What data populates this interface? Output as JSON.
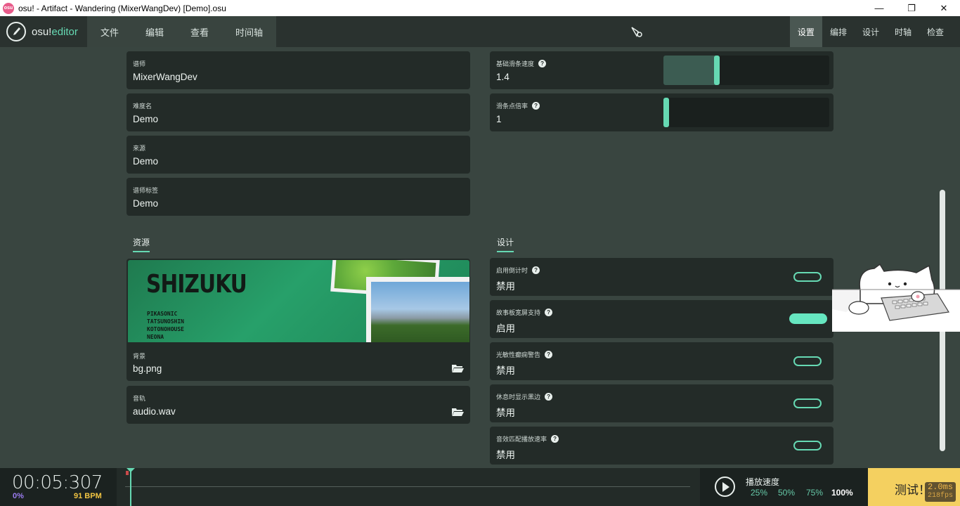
{
  "window": {
    "title": "osu! - Artifact - Wandering (MixerWangDev) [Demo].osu",
    "app_icon_text": "osu",
    "controls": {
      "minimize": "—",
      "maximize": "❐",
      "close": "✕"
    }
  },
  "topbar": {
    "logo": {
      "prefix": "osu!",
      "suffix": "editor"
    },
    "menu": [
      "文件",
      "编辑",
      "查看",
      "时间轴"
    ],
    "modes": [
      "设置",
      "编排",
      "设计",
      "时轴",
      "检查"
    ],
    "active_mode": "设置"
  },
  "metadata": {
    "creator": {
      "label": "谱师",
      "value": "MixerWangDev"
    },
    "difficulty": {
      "label": "难度名",
      "value": "Demo"
    },
    "source": {
      "label": "来源",
      "value": "Demo"
    },
    "tags": {
      "label": "谱师标签",
      "value": "Demo"
    }
  },
  "difficulty_settings": {
    "slider_velocity": {
      "label": "基础滑条速度",
      "value": "1.4",
      "fill": 0.32
    },
    "tick_rate": {
      "label": "滑条点倍率",
      "value": "1",
      "fill": 0.0
    }
  },
  "resources": {
    "title": "资源",
    "preview": {
      "title": "SHIZUKU",
      "credits": [
        "PIKASONIC",
        "TATSUNOSHIN",
        "KOTONOHOUSE",
        "NEONA"
      ]
    },
    "background": {
      "label": "背景",
      "value": "bg.png"
    },
    "audio": {
      "label": "音轨",
      "value": "audio.wav"
    }
  },
  "design": {
    "title": "设计",
    "options": [
      {
        "label": "启用倒计时",
        "value": "禁用",
        "on": false
      },
      {
        "label": "故事板宽屏支持",
        "value": "启用",
        "on": true
      },
      {
        "label": "光敏性癫痫警告",
        "value": "禁用",
        "on": false
      },
      {
        "label": "休息时显示黑边",
        "value": "禁用",
        "on": false
      },
      {
        "label": "音效匹配播放速率",
        "value": "禁用",
        "on": false
      }
    ]
  },
  "bottom": {
    "time": "00:05:307",
    "percent": "0%",
    "bpm": "91 BPM",
    "rate_label": "播放速度",
    "rates": [
      "25%",
      "50%",
      "75%",
      "100%"
    ],
    "selected_rate": "100%",
    "test_label": "测试！",
    "fps": {
      "ms": "2.0ms",
      "frames": "218fps"
    }
  },
  "colors": {
    "accent": "#66d9b3",
    "background": "#394540",
    "panel": "#232b28",
    "test_button": "#f4d060"
  }
}
